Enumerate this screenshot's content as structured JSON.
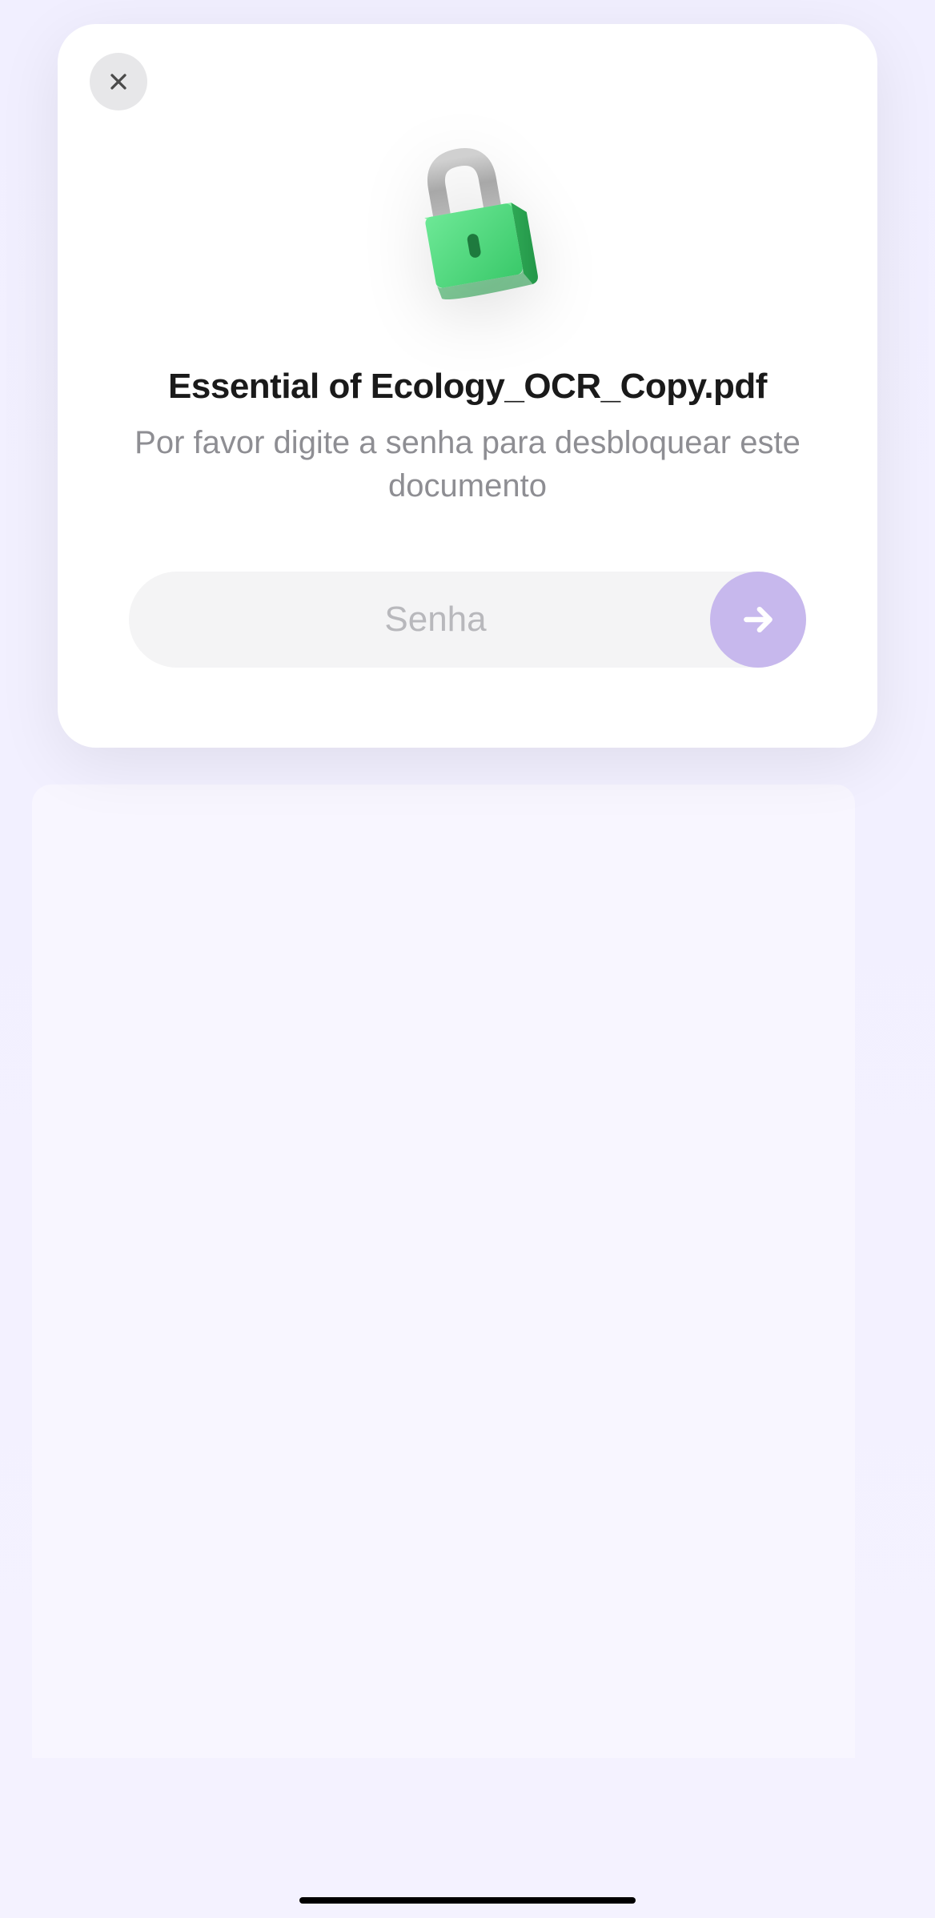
{
  "modal": {
    "document_title": "Essential of Ecology_OCR_Copy.pdf",
    "subtitle": "Por favor digite a senha para desbloquear este documento",
    "password_placeholder": "Senha"
  },
  "icons": {
    "close": "close-icon",
    "lock": "lock-icon",
    "arrow_right": "arrow-right-icon"
  }
}
